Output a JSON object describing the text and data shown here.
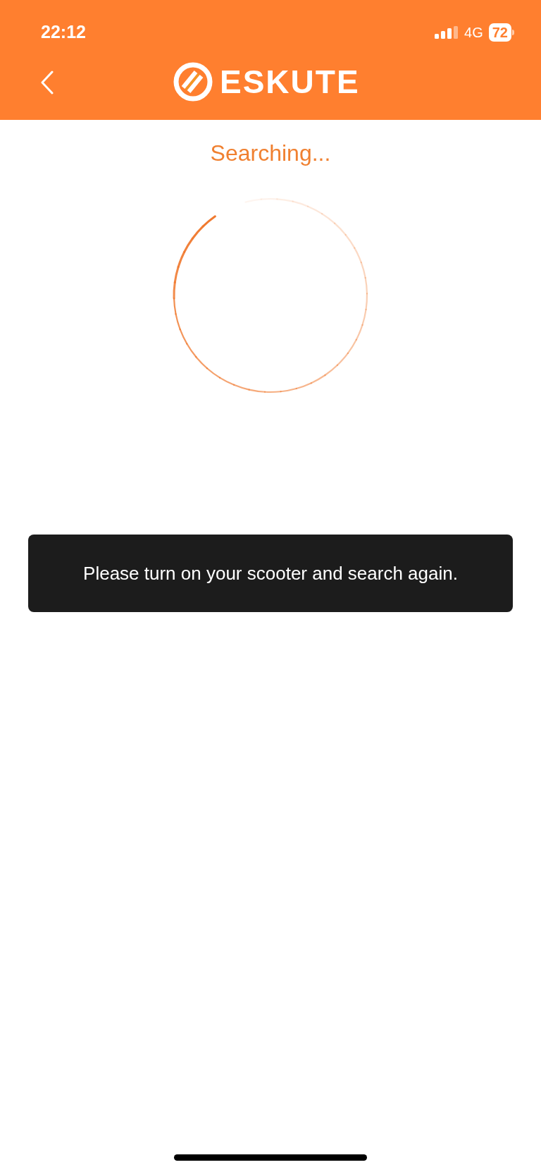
{
  "status_bar": {
    "time": "22:12",
    "network": "4G",
    "battery": "72"
  },
  "header": {
    "brand": "ESKUTE"
  },
  "status_text": "Searching...",
  "toast": "Please turn on your scooter and search again."
}
